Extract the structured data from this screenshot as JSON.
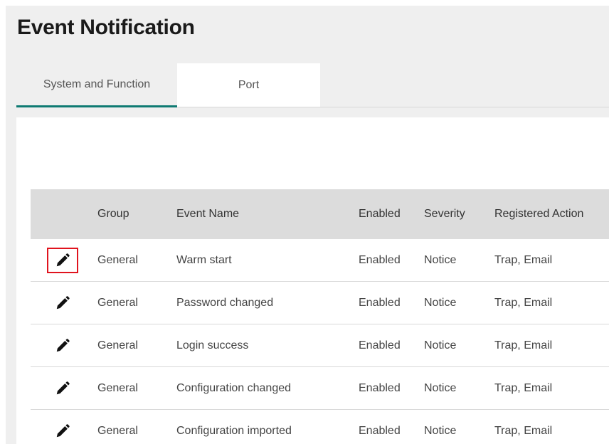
{
  "page": {
    "title": "Event Notification"
  },
  "tabs": [
    {
      "label": "System and Function",
      "active": true
    },
    {
      "label": "Port",
      "active": false
    }
  ],
  "table": {
    "columns": [
      "",
      "Group",
      "Event Name",
      "Enabled",
      "Severity",
      "Registered Action"
    ],
    "rows": [
      {
        "icon": "pencil-icon",
        "group": "General",
        "event": "Warm start",
        "enabled": "Enabled",
        "severity": "Notice",
        "action": "Trap, Email"
      },
      {
        "icon": "pencil-icon",
        "group": "General",
        "event": "Password changed",
        "enabled": "Enabled",
        "severity": "Notice",
        "action": "Trap, Email"
      },
      {
        "icon": "pencil-icon",
        "group": "General",
        "event": "Login success",
        "enabled": "Enabled",
        "severity": "Notice",
        "action": "Trap, Email"
      },
      {
        "icon": "pencil-icon",
        "group": "General",
        "event": "Configuration changed",
        "enabled": "Enabled",
        "severity": "Notice",
        "action": "Trap, Email"
      },
      {
        "icon": "pencil-icon",
        "group": "General",
        "event": "Configuration imported",
        "enabled": "Enabled",
        "severity": "Notice",
        "action": "Trap, Email"
      }
    ]
  },
  "colors": {
    "accent": "#0e7a72",
    "highlight": "#e0141e",
    "header_bg": "#dcdcdc",
    "page_bg": "#efefef"
  }
}
